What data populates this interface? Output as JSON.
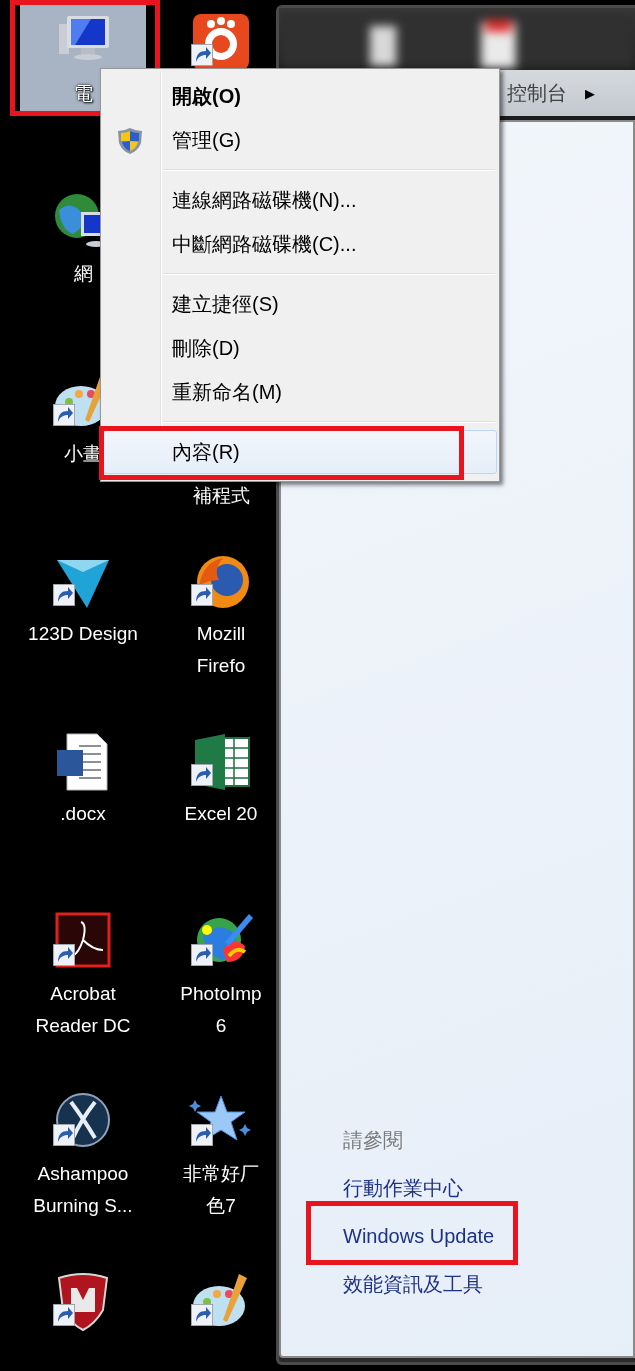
{
  "desktop": {
    "rows": [
      {
        "icons": [
          {
            "label_lines": [
              "電"
            ],
            "selected": true,
            "shortcut": false,
            "annotated": true
          },
          {
            "selected": false,
            "shortcut": true,
            "annotated": false
          }
        ]
      },
      {
        "icons": [
          {
            "label_lines": [
              "網"
            ],
            "selected": false,
            "shortcut": false,
            "annotated": false
          }
        ]
      },
      {
        "icons": [
          {
            "label_lines": [
              "小畫"
            ],
            "selected": false,
            "shortcut": true,
            "annotated": false
          },
          {
            "label_lines": [
              "補程式"
            ],
            "selected": false,
            "annotated": false
          }
        ]
      },
      {
        "icons": [
          {
            "label_lines": [
              "123D Design"
            ],
            "selected": false,
            "shortcut": true,
            "annotated": false
          },
          {
            "label_lines": [
              "Mozill",
              "Firefo"
            ],
            "selected": false,
            "shortcut": true,
            "annotated": false
          }
        ]
      },
      {
        "icons": [
          {
            "label_lines": [
              ".docx"
            ],
            "selected": false,
            "shortcut": false,
            "annotated": false
          },
          {
            "label_lines": [
              "Excel 20"
            ],
            "selected": false,
            "shortcut": true,
            "annotated": false
          }
        ]
      },
      {
        "icons": [
          {
            "label_lines": [
              "Acrobat",
              "Reader DC"
            ],
            "selected": false,
            "shortcut": true,
            "annotated": false
          },
          {
            "label_lines": [
              "PhotoImp",
              "6"
            ],
            "selected": false,
            "shortcut": true,
            "annotated": false
          }
        ]
      },
      {
        "icons": [
          {
            "label_lines": [
              "Ashampoo",
              "Burning S..."
            ],
            "selected": false,
            "shortcut": true,
            "annotated": false
          },
          {
            "label_lines": [
              "非常好厂",
              "色7"
            ],
            "selected": false,
            "shortcut": true,
            "annotated": false
          }
        ]
      },
      {
        "icons": [
          {
            "selected": false,
            "shortcut": true,
            "annotated": false
          },
          {
            "selected": false,
            "shortcut": true,
            "annotated": false
          }
        ]
      }
    ]
  },
  "context_menu": {
    "items": [
      {
        "kind": "item",
        "label": "開啟(O)",
        "default": true,
        "requires_admin": false,
        "highlighted": false,
        "annotated": false
      },
      {
        "kind": "item",
        "label": "管理(G)",
        "default": false,
        "requires_admin": true,
        "highlighted": false,
        "annotated": false
      },
      {
        "kind": "separator"
      },
      {
        "kind": "item",
        "label": "連線網路磁碟機(N)...",
        "default": false,
        "requires_admin": false,
        "highlighted": false,
        "annotated": false
      },
      {
        "kind": "item",
        "label": "中斷網路磁碟機(C)...",
        "default": false,
        "requires_admin": false,
        "highlighted": false,
        "annotated": false
      },
      {
        "kind": "separator"
      },
      {
        "kind": "item",
        "label": "建立捷徑(S)",
        "default": false,
        "requires_admin": false,
        "highlighted": false,
        "annotated": false
      },
      {
        "kind": "item",
        "label": "刪除(D)",
        "default": false,
        "requires_admin": false,
        "highlighted": false,
        "annotated": false
      },
      {
        "kind": "item",
        "label": "重新命名(M)",
        "default": false,
        "requires_admin": false,
        "highlighted": false,
        "annotated": false
      },
      {
        "kind": "separator"
      },
      {
        "kind": "item",
        "label": "內容(R)",
        "default": false,
        "requires_admin": false,
        "highlighted": true,
        "annotated": true
      }
    ]
  },
  "window": {
    "breadcrumb": [
      "控制台"
    ],
    "breadcrumb_separator": "▶",
    "see_also": {
      "heading": "請參閱",
      "links": [
        {
          "label": "行動作業中心",
          "annotated": false
        },
        {
          "label": "Windows Update",
          "annotated": true
        },
        {
          "label": "效能資訊及工具",
          "annotated": false
        }
      ]
    }
  }
}
